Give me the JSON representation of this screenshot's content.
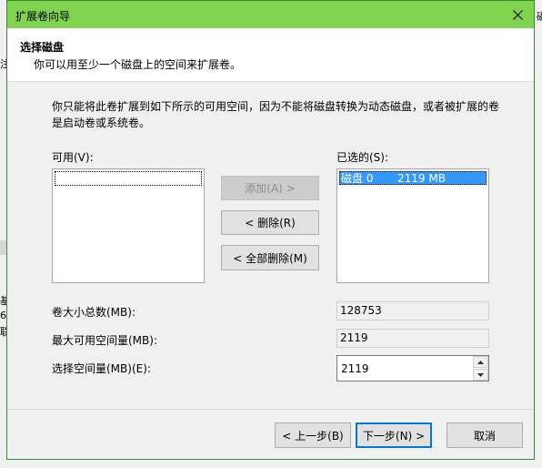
{
  "dialog": {
    "title": "扩展卷向导"
  },
  "header": {
    "title": "选择磁盘",
    "subtitle": "你可以用至少一个磁盘上的空间来扩展卷。"
  },
  "description": "你只能将此卷扩展到如下所示的可用空间，因为不能将磁盘转换为动态磁盘，或者被扩展的卷是启动卷或系统卷。",
  "available": {
    "label": "可用(V):",
    "items": []
  },
  "selected": {
    "label": "已选的(S):",
    "items": [
      {
        "disk": "磁盘 0",
        "size": "2119 MB"
      }
    ]
  },
  "buttons": {
    "add": "添加(A) >",
    "remove": "< 删除(R)",
    "remove_all": "< 全部删除(M)",
    "back": "< 上一步(B)",
    "next": "下一步(N) >",
    "cancel": "取消"
  },
  "fields": {
    "total_label": "卷大小总数(MB):",
    "total_value": "128753",
    "max_label": "最大可用空间量(MB):",
    "max_value": "2119",
    "select_label": "选择空间量(MB)(E):",
    "select_value": "2119"
  },
  "background": {
    "frag_top_right": "磁",
    "frag_left_1": "注",
    "frag_left_2": "基",
    "frag_left_3": "6",
    "frag_left_4": "联"
  }
}
